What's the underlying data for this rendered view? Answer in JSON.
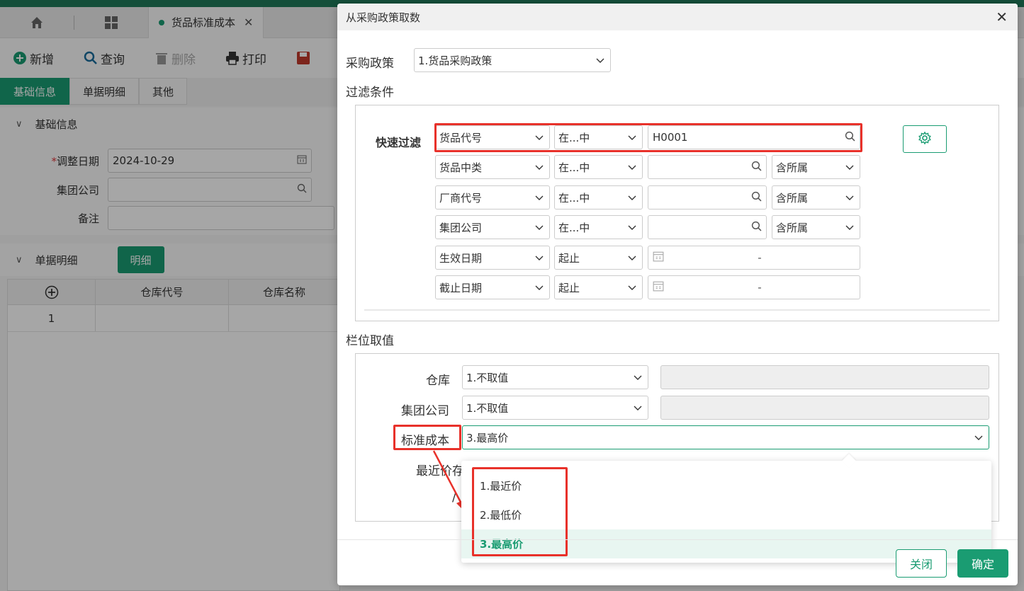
{
  "app": {
    "tab_title": "货品标准成本",
    "toolbar": {
      "add": "新增",
      "query": "查询",
      "delete": "删除",
      "print": "打印"
    },
    "section_tabs": [
      "基础信息",
      "单据明细",
      "其他"
    ],
    "basic_panel": {
      "title": "基础信息",
      "adjust_date_label": "调整日期",
      "adjust_date_value": "2024-10-29",
      "group_company_label": "集团公司",
      "remark_label": "备注"
    },
    "detail_panel": {
      "title": "单据明细",
      "detail_button": "明细",
      "columns": [
        "仓库代号",
        "仓库名称"
      ],
      "rows": [
        {
          "no": "1"
        }
      ]
    }
  },
  "modal": {
    "title": "从采购政策取数",
    "policy_label": "采购政策",
    "policy_value": "1.货品采购政策",
    "filter_section": "过滤条件",
    "quick_filter_label": "快速过滤",
    "filters": [
      {
        "field": "货品代号",
        "op": "在...中",
        "value": "H0001",
        "scope": ""
      },
      {
        "field": "货品中类",
        "op": "在...中",
        "value": "",
        "scope": "含所属"
      },
      {
        "field": "厂商代号",
        "op": "在...中",
        "value": "",
        "scope": "含所属"
      },
      {
        "field": "集团公司",
        "op": "在...中",
        "value": "",
        "scope": "含所属"
      },
      {
        "field": "生效日期",
        "op": "起止",
        "value": "-",
        "scope": ""
      },
      {
        "field": "截止日期",
        "op": "起止",
        "value": "-",
        "scope": ""
      }
    ],
    "column_section": "栏位取值",
    "columns": [
      {
        "label": "仓库",
        "value": "1.不取值"
      },
      {
        "label": "集团公司",
        "value": "1.不取值"
      },
      {
        "label": "标准成本",
        "value": "3.最高价"
      },
      {
        "label": "最近价存",
        "value": ""
      }
    ],
    "dropdown_options": [
      "1.最近价",
      "2.最低价",
      "3.最高价"
    ],
    "dropdown_selected": "3.最高价",
    "close_button": "关闭",
    "confirm_button": "确定"
  },
  "colors": {
    "accent": "#1a9c72",
    "highlight": "#e8312a"
  }
}
